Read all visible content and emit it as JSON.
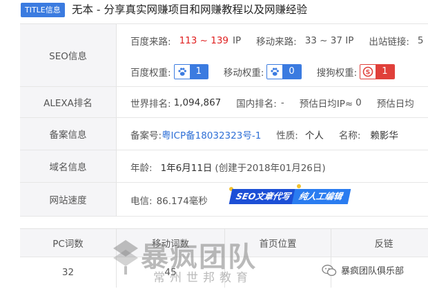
{
  "title": {
    "badge": "TITLE信息",
    "text": "无本 - 分享真实网赚项目和网赚教程以及网赚经验"
  },
  "seo": {
    "label": "SEO信息",
    "baidu_source_label": "百度来路:",
    "baidu_source_value": "113 ~ 139",
    "baidu_source_unit": "IP",
    "mobile_source_label": "移动来路:",
    "mobile_source_value": "33 ~ 37 IP",
    "outbound_label": "出站链接:",
    "outbound_value": "5",
    "baidu_weight_label": "百度权重:",
    "baidu_weight_value": "1",
    "mobile_weight_label": "移动权重:",
    "mobile_weight_value": "0",
    "sogou_weight_label": "搜狗权重:",
    "sogou_weight_value": "1"
  },
  "alexa": {
    "label": "ALEXA排名",
    "world_label": "世界排名:",
    "world_value": "1,094,867",
    "domestic_label": "国内排名:",
    "domestic_value": "-",
    "daily_ip_label": "预估日均IP≈",
    "daily_ip_value": "0",
    "daily_pv_label": "预估日均"
  },
  "icp": {
    "label": "备案信息",
    "number_label": "备案号:",
    "number_value": "粤ICP备18032323号-1",
    "nature_label": "性质:",
    "nature_value": "个人",
    "name_label": "名称:",
    "name_value": "赖影华"
  },
  "domain": {
    "label": "域名信息",
    "age_label": "年龄:",
    "age_value": "1年6月11日",
    "created": "(创建于2018年01月26日)"
  },
  "speed": {
    "label": "网站速度",
    "telecom_label": "电信:",
    "telecom_value": "86.174毫秒",
    "ad_left": "SEO文章代写",
    "ad_right": "纯人工编辑"
  },
  "keywords": {
    "headers": [
      "PC词数",
      "移动词数",
      "首页位置",
      "反链"
    ],
    "values": [
      "32",
      "45",
      "",
      ""
    ]
  },
  "watermark": {
    "main": "暴疯团队",
    "sub": "常州世邦教育"
  },
  "wechat_label": "暴疯团队俱乐部",
  "colors": {
    "accent": "#3b7be0",
    "danger": "#e02020",
    "sogou": "#e0403a"
  },
  "icons": [
    "paw-icon",
    "sogou-icon",
    "wechat-icon"
  ]
}
